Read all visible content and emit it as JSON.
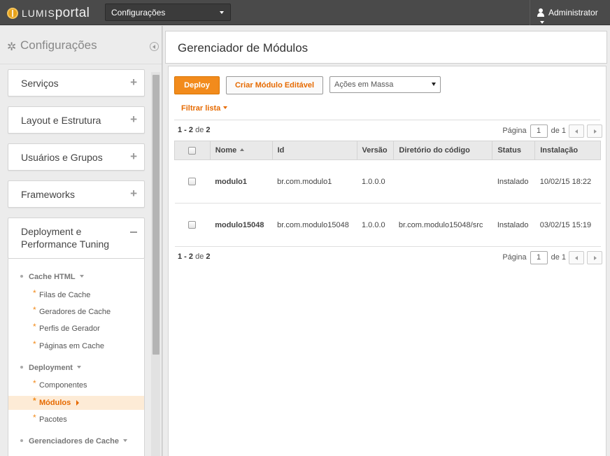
{
  "topbar": {
    "brand_prefix": "LUMIS",
    "brand_suffix": "portal",
    "site_select": "Configurações",
    "user": "Administrator"
  },
  "sidebar": {
    "title": "Configurações",
    "sections": [
      {
        "label": "Serviços"
      },
      {
        "label": "Layout e Estrutura"
      },
      {
        "label": "Usuários e Grupos"
      },
      {
        "label": "Frameworks"
      },
      {
        "label": "Deployment e Performance Tuning"
      }
    ],
    "tree": {
      "cache_html": "Cache HTML",
      "cache_items": [
        "Filas de Cache",
        "Geradores de Cache",
        "Perfis de Gerador",
        "Páginas em Cache"
      ],
      "deployment": "Deployment",
      "deployment_items": [
        "Componentes",
        "Módulos",
        "Pacotes"
      ],
      "gerenciadores": "Gerenciadores de Cache"
    }
  },
  "main": {
    "title": "Gerenciador de Módulos",
    "deploy_btn": "Deploy",
    "criar_btn": "Criar Módulo Editável",
    "acoes_select": "Ações em Massa",
    "filtrar": "Filtrar lista",
    "count_range": "1 - 2",
    "count_of": "de",
    "count_total": "2",
    "pager": {
      "label": "Página",
      "page": "1",
      "of": "de 1"
    },
    "columns": [
      "Nome",
      "Id",
      "Versão",
      "Diretório do código",
      "Status",
      "Instalação"
    ],
    "rows": [
      {
        "nome": "modulo1",
        "id": "br.com.modulo1",
        "versao": "1.0.0.0",
        "dir": "",
        "status": "Instalado",
        "instalacao": "10/02/15 18:22"
      },
      {
        "nome": "modulo15048",
        "id": "br.com.modulo15048",
        "versao": "1.0.0.0",
        "dir": "br.com.modulo15048/src",
        "status": "Instalado",
        "instalacao": "03/02/15 15:19"
      }
    ]
  },
  "colors": {
    "accent": "#f28b1c",
    "accent_text": "#e66a00",
    "topbar": "#4a4a4a"
  },
  "icons": [
    "globe-logo-icon",
    "chevron-down-icon",
    "user-icon",
    "gear-icon",
    "collapse-left-icon",
    "plus-icon",
    "minus-icon",
    "chevron-left-icon",
    "chevron-right-icon",
    "sort-asc-icon"
  ]
}
